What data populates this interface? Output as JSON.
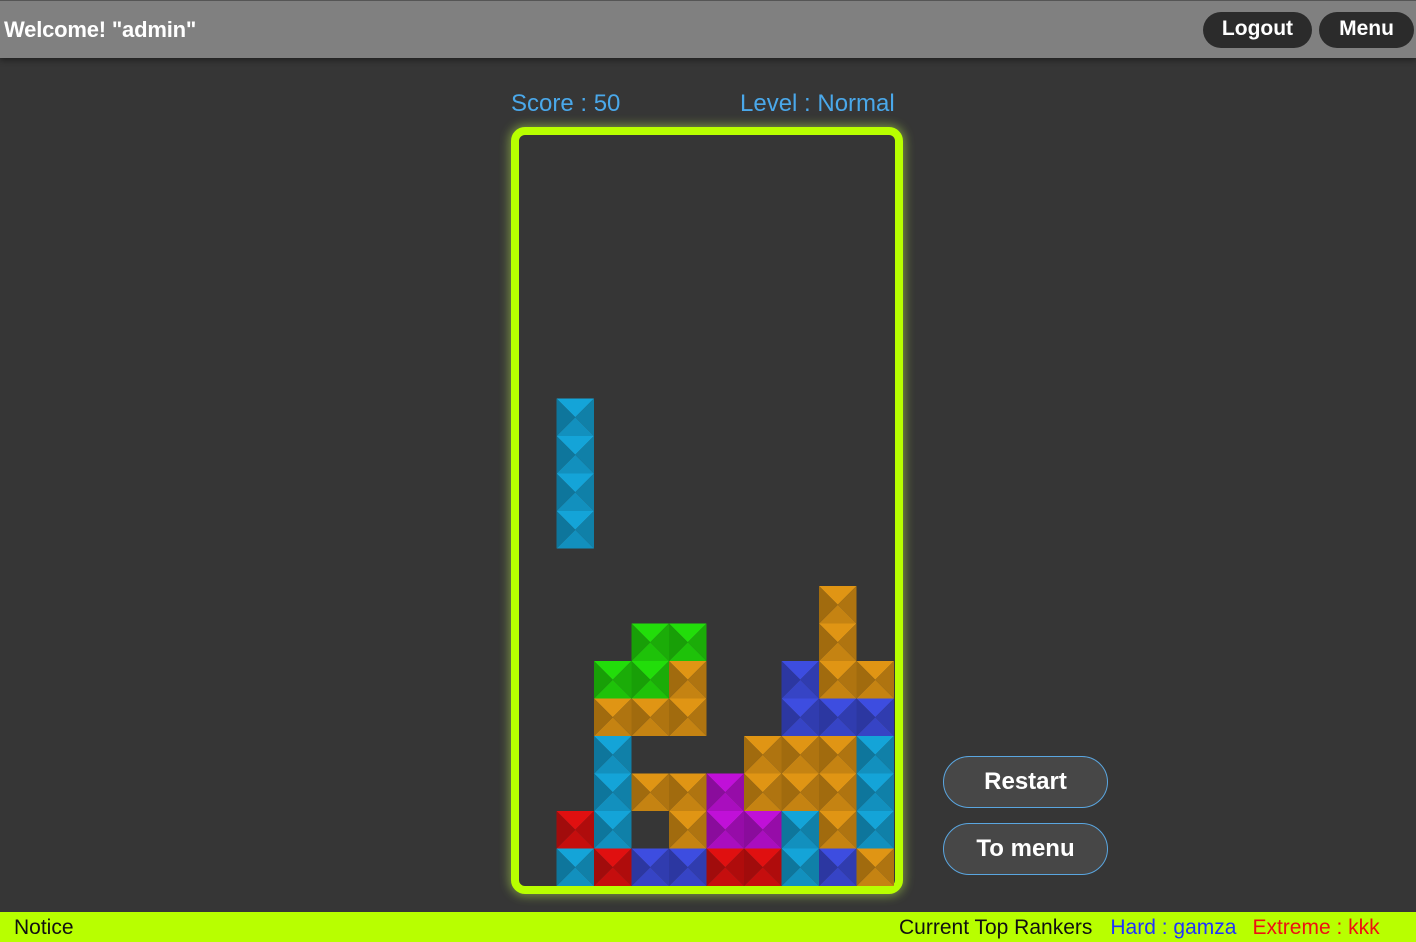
{
  "header": {
    "welcome": "Welcome! \"admin\"",
    "logout_label": "Logout",
    "menu_label": "Menu"
  },
  "game": {
    "score_text": "Score : 50",
    "level_text": "Level : Normal",
    "colors": {
      "cyan": "#14a4d8",
      "orange": "#e09514",
      "green": "#22dd0a",
      "blue": "#3d4de0",
      "red": "#e01010",
      "purple": "#c010d8",
      "frame": "#b8ff00"
    },
    "active_piece": {
      "color": "cyan",
      "cells": [
        [
          0,
          7
        ],
        [
          0,
          8
        ],
        [
          0,
          9
        ],
        [
          0,
          10
        ]
      ]
    },
    "settled_cells": [
      [
        7,
        12,
        "orange"
      ],
      [
        2,
        13,
        "green"
      ],
      [
        3,
        13,
        "green"
      ],
      [
        7,
        13,
        "orange"
      ],
      [
        1,
        14,
        "green"
      ],
      [
        2,
        14,
        "green"
      ],
      [
        3,
        14,
        "orange"
      ],
      [
        6,
        14,
        "blue"
      ],
      [
        7,
        14,
        "orange"
      ],
      [
        8,
        14,
        "orange"
      ],
      [
        1,
        15,
        "orange"
      ],
      [
        2,
        15,
        "orange"
      ],
      [
        3,
        15,
        "orange"
      ],
      [
        6,
        15,
        "blue"
      ],
      [
        7,
        15,
        "blue"
      ],
      [
        8,
        15,
        "blue"
      ],
      [
        1,
        16,
        "cyan"
      ],
      [
        5,
        16,
        "orange"
      ],
      [
        6,
        16,
        "orange"
      ],
      [
        7,
        16,
        "orange"
      ],
      [
        8,
        16,
        "cyan"
      ],
      [
        1,
        17,
        "cyan"
      ],
      [
        2,
        17,
        "orange"
      ],
      [
        3,
        17,
        "orange"
      ],
      [
        4,
        17,
        "purple"
      ],
      [
        5,
        17,
        "orange"
      ],
      [
        6,
        17,
        "orange"
      ],
      [
        7,
        17,
        "orange"
      ],
      [
        8,
        17,
        "cyan"
      ],
      [
        0,
        18,
        "red"
      ],
      [
        1,
        18,
        "cyan"
      ],
      [
        3,
        18,
        "orange"
      ],
      [
        4,
        18,
        "purple"
      ],
      [
        5,
        18,
        "purple"
      ],
      [
        6,
        18,
        "cyan"
      ],
      [
        7,
        18,
        "orange"
      ],
      [
        8,
        18,
        "cyan"
      ],
      [
        0,
        19,
        "cyan"
      ],
      [
        1,
        19,
        "red"
      ],
      [
        2,
        19,
        "blue"
      ],
      [
        3,
        19,
        "blue"
      ],
      [
        4,
        19,
        "red"
      ],
      [
        5,
        19,
        "red"
      ],
      [
        6,
        19,
        "cyan"
      ],
      [
        7,
        19,
        "blue"
      ],
      [
        8,
        19,
        "orange"
      ]
    ]
  },
  "actions": {
    "restart_label": "Restart",
    "to_menu_label": "To menu"
  },
  "footer": {
    "notice": "Notice",
    "rankers_title": "Current Top Rankers",
    "hard": "Hard : gamza",
    "extreme": "Extreme : kkk"
  }
}
